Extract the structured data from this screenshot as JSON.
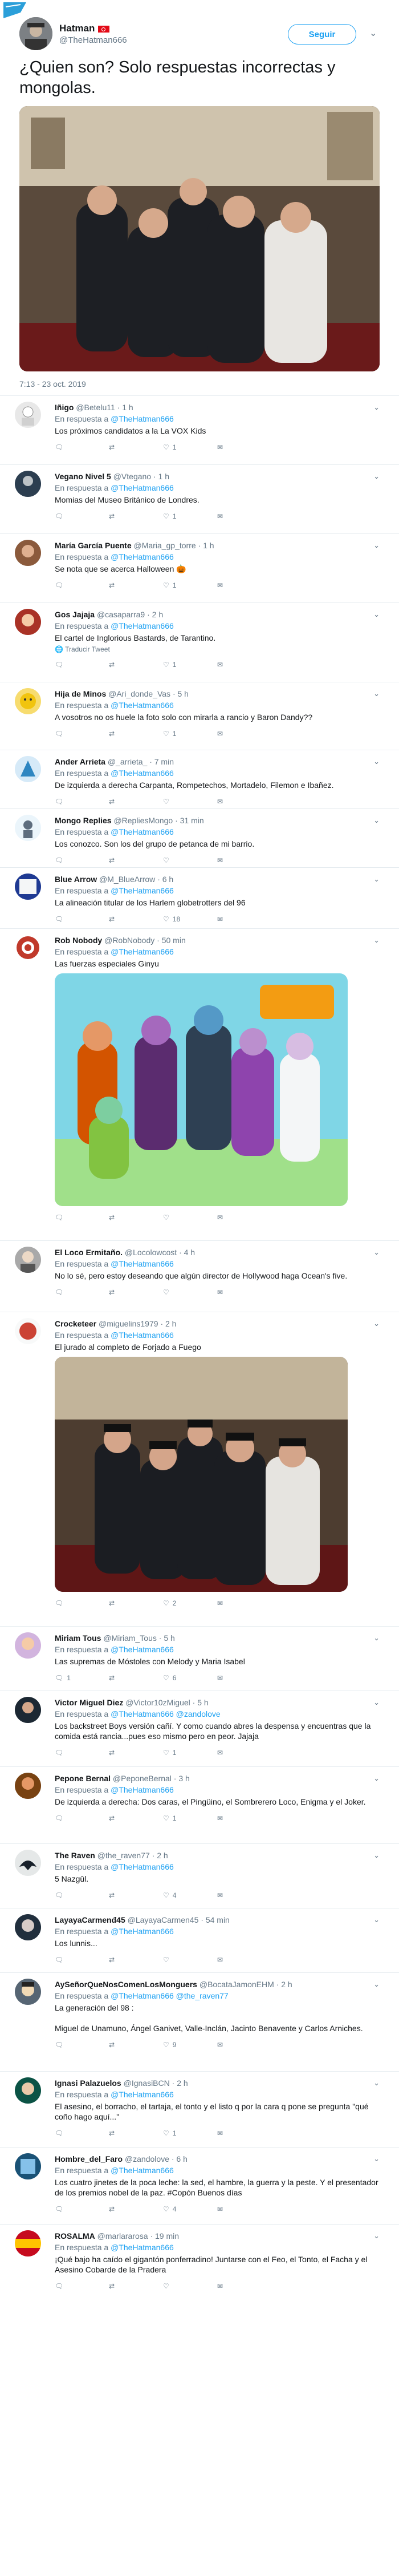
{
  "colors": {
    "accent": "#1da1f2",
    "muted": "#657786",
    "text": "#14171a",
    "border": "#e6ecf0"
  },
  "header": {
    "name": "Hatman",
    "handle": "@TheHatman666",
    "follow_label": "Seguir"
  },
  "tweet": {
    "text": "¿Quien son? Solo respuestas incorrectas y mongolas.",
    "date": "7:13 - 23 oct. 2019"
  },
  "replies": [
    {
      "name": "Iñigo",
      "handle": "@Betelu11",
      "time": "· 1 h",
      "reply_to": "@TheHatman666",
      "text": "Los próximos candidatos a la La VOX Kids",
      "counts": [
        "",
        "",
        "1",
        ""
      ]
    },
    {
      "name": "Vegano Nivel 5",
      "handle": "@Vtegano",
      "time": "· 1 h",
      "reply_to": "@TheHatman666",
      "text": "Momias del Museo Británico de Londres.",
      "counts": [
        "",
        "",
        "1",
        ""
      ]
    },
    {
      "name": "María García Puente",
      "handle": "@Maria_gp_torre",
      "time": "· 1 h",
      "reply_to": "@TheHatman666",
      "text": "Se nota que se acerca Halloween 🎃",
      "counts": [
        "",
        "",
        "1",
        ""
      ]
    },
    {
      "name": "Gos Jajaja",
      "handle": "@casaparra9",
      "time": "· 2 h",
      "reply_to": "@TheHatman666",
      "text": "El cartel de Inglorious Bastards, de Tarantino.",
      "translate": "Traducir Tweet",
      "counts": [
        "",
        "",
        "1",
        ""
      ]
    },
    {
      "name": "Hija de Minos",
      "handle": "@Ari_donde_Vas",
      "time": "· 5 h",
      "reply_to": "@TheHatman666",
      "text": "A vosotros no os huele la foto solo con mirarla a rancio y Baron Dandy??",
      "counts": [
        "",
        "",
        "1",
        ""
      ]
    },
    {
      "name": "Ander Arrieta",
      "handle": "@_arrieta_",
      "time": "· 7 min",
      "reply_to": "@TheHatman666",
      "text": "De izquierda a derecha Carpanta, Rompetechos, Mortadelo, Filemon e Ibañez.",
      "counts": [
        "",
        "",
        "",
        ""
      ]
    },
    {
      "name": "Mongo Replies",
      "handle": "@RepliesMongo",
      "time": "· 31 min",
      "reply_to": "@TheHatman666",
      "text": "Los conozco. Son los del grupo de petanca de mi barrio.",
      "counts": [
        "",
        "",
        "",
        ""
      ]
    },
    {
      "name": "Blue Arrow",
      "handle": "@M_BlueArrow",
      "time": "· 6 h",
      "reply_to": "@TheHatman666",
      "text": "La alineación titular de los Harlem globetrotters del 96",
      "counts": [
        "",
        "",
        "18",
        ""
      ]
    },
    {
      "name": "Rob Nobody",
      "handle": "@RobNobody",
      "time": "· 50 min",
      "reply_to": "@TheHatman666",
      "text": "Las fuerzas especiales Ginyu",
      "counts": [
        "",
        "",
        "",
        ""
      ]
    },
    {
      "name": "El Loco Ermitaño.",
      "handle": "@Locolowcost",
      "time": "· 4 h",
      "reply_to": "@TheHatman666",
      "text": "No lo sé, pero estoy deseando que algún director de Hollywood haga Ocean's five.",
      "counts": [
        "",
        "",
        "",
        ""
      ]
    },
    {
      "name": "Crocketeer",
      "handle": "@miguelins1979",
      "time": "· 2 h",
      "reply_to": "@TheHatman666",
      "text": "El jurado al completo de Forjado a Fuego",
      "counts": [
        "",
        "",
        "2",
        ""
      ]
    },
    {
      "name": "Miriam Tous",
      "handle": "@Miriam_Tous",
      "time": "· 5 h",
      "reply_to": "@TheHatman666",
      "text": "Las supremas de Móstoles con Melody y Maria Isabel",
      "counts": [
        "1",
        "",
        "6",
        ""
      ]
    },
    {
      "name": "Victor Miguel Diez",
      "handle": "@Victor10zMiguel",
      "time": "· 5 h",
      "reply_to": "@TheHatman666 @zandolove",
      "text": "Los backstreet Boys versión cañí. Y como cuando abres la despensa y encuentras que la comida está rancia...pues eso mismo pero en peor. Jajaja",
      "counts": [
        "",
        "",
        "1",
        ""
      ]
    },
    {
      "name": "Pepone Bernal",
      "handle": "@PeponeBernal",
      "time": "· 3 h",
      "reply_to": "@TheHatman666",
      "text": "De izquierda a derecha: Dos caras, el Pingüino, el Sombrerero Loco, Enigma y el Joker.",
      "counts": [
        "",
        "",
        "1",
        ""
      ]
    },
    {
      "name": "The Raven",
      "handle": "@the_raven77",
      "time": "· 2 h",
      "reply_to": "@TheHatman666",
      "text": "5 Nazgûl.",
      "counts": [
        "",
        "",
        "4",
        ""
      ]
    },
    {
      "name": "LayayaCarmenđ45",
      "handle": "@LayayaCarmen45",
      "time": "· 54 min",
      "reply_to": "@TheHatman666",
      "text": "Los lunnis...",
      "counts": [
        "",
        "",
        "",
        ""
      ]
    },
    {
      "name": "AySeñorQueNosComenLosMonguers",
      "handle": "@BocataJamonEHM",
      "time": "· 2 h",
      "reply_to": "@TheHatman666 @the_raven77",
      "text": "La generación del 98 :\n\nMiguel de Unamuno, Ángel Ganivet, Valle-Inclán, Jacinto Benavente y Carlos Arniches.",
      "counts": [
        "",
        "",
        "9",
        ""
      ]
    },
    {
      "name": "Ignasi Palazuelos",
      "handle": "@IgnasiBCN",
      "time": "· 2 h",
      "reply_to": "@TheHatman666",
      "text": "El asesino, el borracho, el tartaja, el tonto y el listo q por la cara q pone se pregunta \"qué coño hago aquí...\"",
      "counts": [
        "",
        "",
        "1",
        ""
      ]
    },
    {
      "name": "Hombre_del_Faro",
      "handle": "@zandolove",
      "time": "· 6 h",
      "reply_to": "@TheHatman666",
      "text": "Los cuatro jinetes de la poca leche: la sed, el hambre, la guerra y la peste. Y el presentador de los premios nobel de la paz. #Copón Buenos días",
      "counts": [
        "",
        "",
        "4",
        ""
      ]
    },
    {
      "name": "ROSALMA",
      "handle": "@marlararosa",
      "time": "· 19 min",
      "reply_to": "@TheHatman666",
      "text": "¡Qué bajo ha caído el gigantón ponferradino! Juntarse con el  Feo, el Tonto, el Facha y el Asesino Cobarde de la Pradera",
      "counts": [
        "",
        "",
        "",
        ""
      ]
    }
  ],
  "common": {
    "reply_prefix": "En respuesta a"
  }
}
